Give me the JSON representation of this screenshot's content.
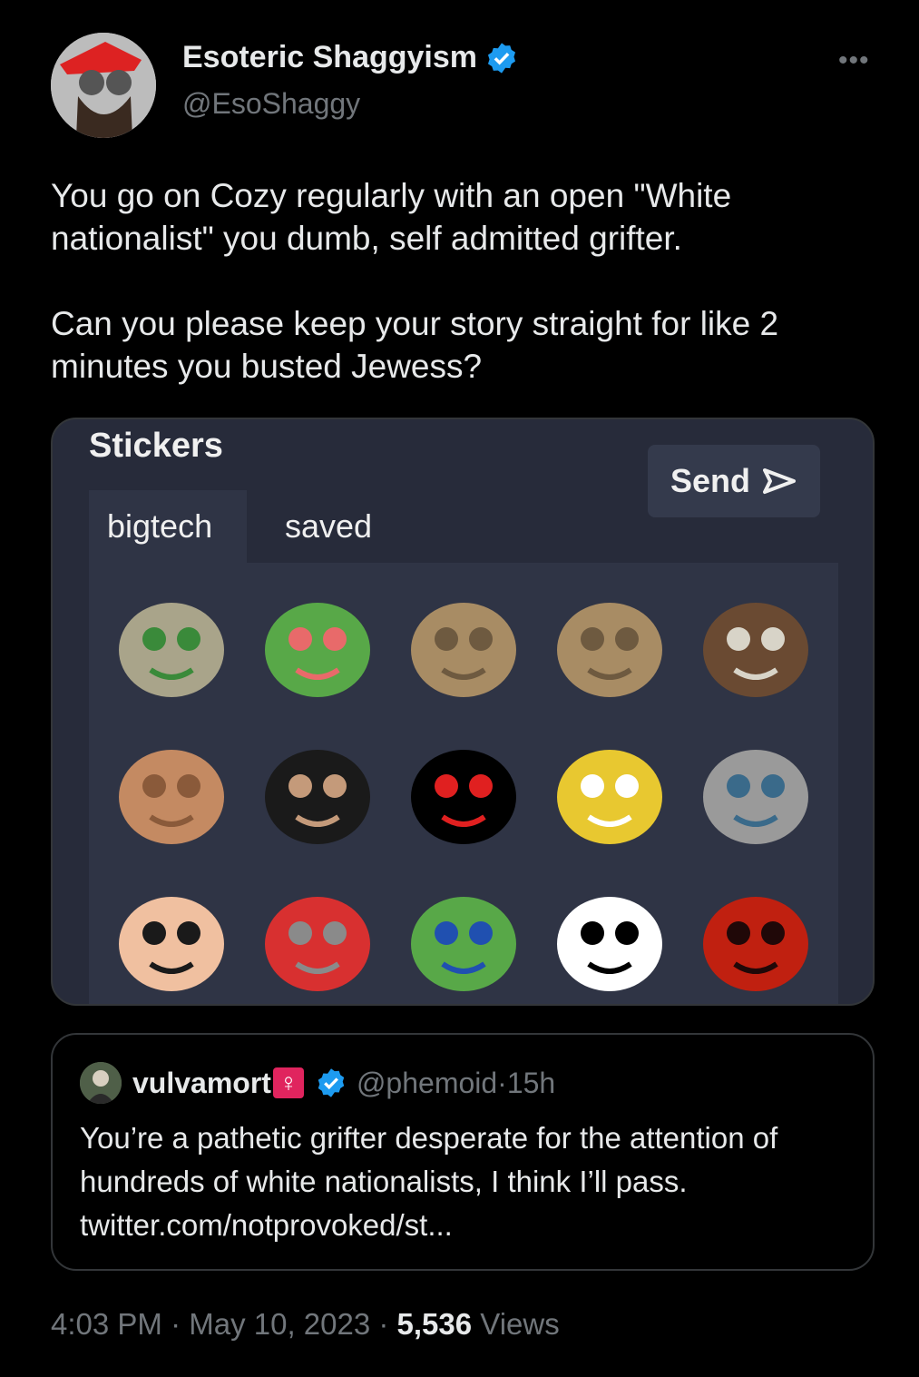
{
  "tweet": {
    "display_name": "Esoteric Shaggyism",
    "handle": "@EsoShaggy",
    "more_label": "•••",
    "text": "You go on Cozy regularly with an open \"White nationalist\" you dumb, self admitted grifter.\n\nCan you please keep your story straight for like 2 minutes you busted Jewess?",
    "time": "4:03 PM",
    "sep1": " · ",
    "date": "May 10, 2023",
    "sep2": " · ",
    "views_count": "5,536",
    "views_label": " Views"
  },
  "stickers": {
    "title": "Stickers",
    "send_label": "Send",
    "tabs": [
      {
        "label": "bigtech",
        "active": true
      },
      {
        "label": "saved",
        "active": false
      }
    ],
    "items": [
      {
        "icon": "helmet-frog-soldier-icon",
        "colors": [
          "#a9a48a",
          "#3a8a3a"
        ]
      },
      {
        "icon": "pepe-knife-icon",
        "colors": [
          "#58a848",
          "#e86a6a"
        ]
      },
      {
        "icon": "cat-face-icon",
        "colors": [
          "#a88c64",
          "#6e5a40"
        ]
      },
      {
        "icon": "cat-face-icon",
        "colors": [
          "#a88c64",
          "#6e5a40"
        ]
      },
      {
        "icon": "letter-n-pattern-icon",
        "colors": [
          "#6a4a32",
          "#d8d4c8"
        ]
      },
      {
        "icon": "bald-man-icon",
        "colors": [
          "#c48a62",
          "#8a5a3a"
        ]
      },
      {
        "icon": "suited-man-icon",
        "colors": [
          "#1a1a1a",
          "#c49a7a"
        ]
      },
      {
        "icon": "red-starfish-laser-icon",
        "colors": [
          "#000000",
          "#e02020"
        ]
      },
      {
        "icon": "cartoon-duck-icon",
        "colors": [
          "#e8c830",
          "#ffffff"
        ]
      },
      {
        "icon": "cat-pickaxe-icon",
        "colors": [
          "#9a9a9a",
          "#3a6a8a"
        ]
      },
      {
        "icon": "laughing-man-cap-icon",
        "colors": [
          "#f0c0a0",
          "#1a1a1a"
        ]
      },
      {
        "icon": "man-red-cap-mic-icon",
        "colors": [
          "#d83030",
          "#8a8a8a"
        ]
      },
      {
        "icon": "pepe-robe-icon",
        "colors": [
          "#58a848",
          "#2050b0"
        ]
      },
      {
        "icon": "soyjak-face-icon",
        "colors": [
          "#ffffff",
          "#000000"
        ]
      },
      {
        "icon": "red-hooded-figure-icon",
        "colors": [
          "#c02010",
          "#200808"
        ]
      }
    ]
  },
  "quote": {
    "name": "vulvamort",
    "badge": "♀",
    "handle": "@phemoid",
    "dot": " · ",
    "age": "15h",
    "text": "You’re a pathetic grifter desperate for the attention of hundreds of white nationalists, I think I’ll pass.\ntwitter.com/notprovoked/st..."
  }
}
